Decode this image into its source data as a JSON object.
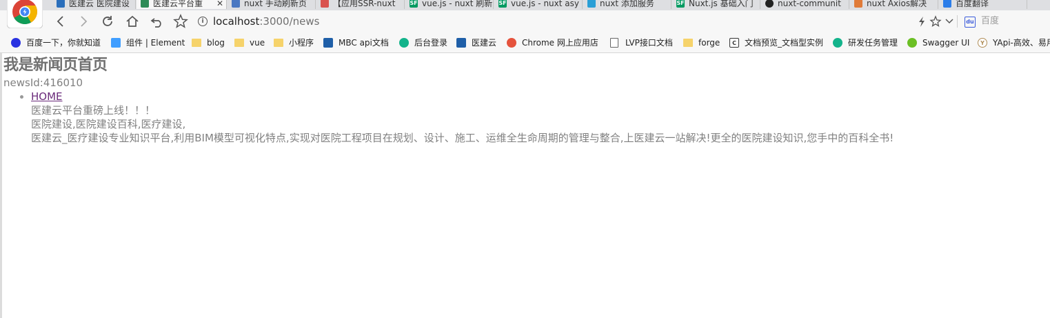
{
  "tabs": [
    {
      "title": "医建云 医院建设",
      "favicon": "blue-square-icon",
      "color": "#2a6ebb"
    },
    {
      "title": "医建云平台重",
      "favicon": "yijianyun-icon",
      "color": "#2e8b57",
      "active": true
    },
    {
      "title": "nuxt 手动刷新页",
      "favicon": "globe-icon",
      "color": "#4a78c2"
    },
    {
      "title": "【应用SSR-nuxt",
      "favicon": "red-icon",
      "color": "#d9534f"
    },
    {
      "title": "vue.js - nuxt 刷新",
      "favicon": "sf-icon",
      "color": "#009a61"
    },
    {
      "title": "vue.js - nuxt asy",
      "favicon": "sf-icon",
      "color": "#009a61"
    },
    {
      "title": "nuxt 添加服务",
      "favicon": "cloud-icon",
      "color": "#2a9fd6"
    },
    {
      "title": "Nuxt.js 基础入门",
      "favicon": "sf-icon",
      "color": "#009a61"
    },
    {
      "title": "nuxt-communit",
      "favicon": "github-icon",
      "color": "#222222"
    },
    {
      "title": "nuxt Axios解决",
      "favicon": "orange-icon",
      "color": "#e07b39"
    },
    {
      "title": "百度翻译",
      "favicon": "translate-icon",
      "color": "#2b7de9"
    }
  ],
  "toolbar": {
    "url_host": "localhost",
    "url_path": ":3000/news",
    "search_placeholder": "百度"
  },
  "bookmarks": [
    {
      "label": "百度一下，你就知道",
      "icon": "baidu-paw-icon",
      "color": "#2932e1"
    },
    {
      "label": "组件 | Element",
      "icon": "element-icon",
      "color": "#409eff"
    },
    {
      "label": "blog",
      "icon": "folder-icon"
    },
    {
      "label": "vue",
      "icon": "folder-icon"
    },
    {
      "label": "小程序",
      "icon": "folder-icon"
    },
    {
      "label": "MBC api文档",
      "icon": "building-icon",
      "color": "#1f5fa8"
    },
    {
      "label": "后台登录",
      "icon": "teal-bolt-icon",
      "color": "#13b38b"
    },
    {
      "label": "医建云",
      "icon": "building-icon",
      "color": "#1f5fa8"
    },
    {
      "label": "Chrome 网上应用店",
      "icon": "rainbow-icon",
      "color": "#e5533d"
    },
    {
      "label": "LVP接口文档",
      "icon": "page-icon"
    },
    {
      "label": "forge",
      "icon": "folder-icon"
    },
    {
      "label": "文档预览_文档型实例",
      "icon": "bracket-icon",
      "color": "#333333"
    },
    {
      "label": "研发任务管理",
      "icon": "teal-bolt-icon",
      "color": "#13b38b"
    },
    {
      "label": "Swagger UI",
      "icon": "swagger-icon",
      "color": "#6bbf24"
    },
    {
      "label": "YApi-高效、易用",
      "icon": "yapi-icon",
      "color": "#b08d57"
    }
  ],
  "page": {
    "heading": "我是新闻页首页",
    "news_id": "newsId:416010",
    "home_link": "HOME",
    "lines": [
      "医建云平台重磅上线！！！",
      "医院建设,医院建设百科,医疗建设,",
      "医建云_医疗建设专业知识平台,利用BIM模型可视化特点,实现对医院工程项目在规划、设计、施工、运维全生命周期的管理与整合,上医建云一站解决!更全的医院建设知识,您手中的百科全书!"
    ]
  }
}
